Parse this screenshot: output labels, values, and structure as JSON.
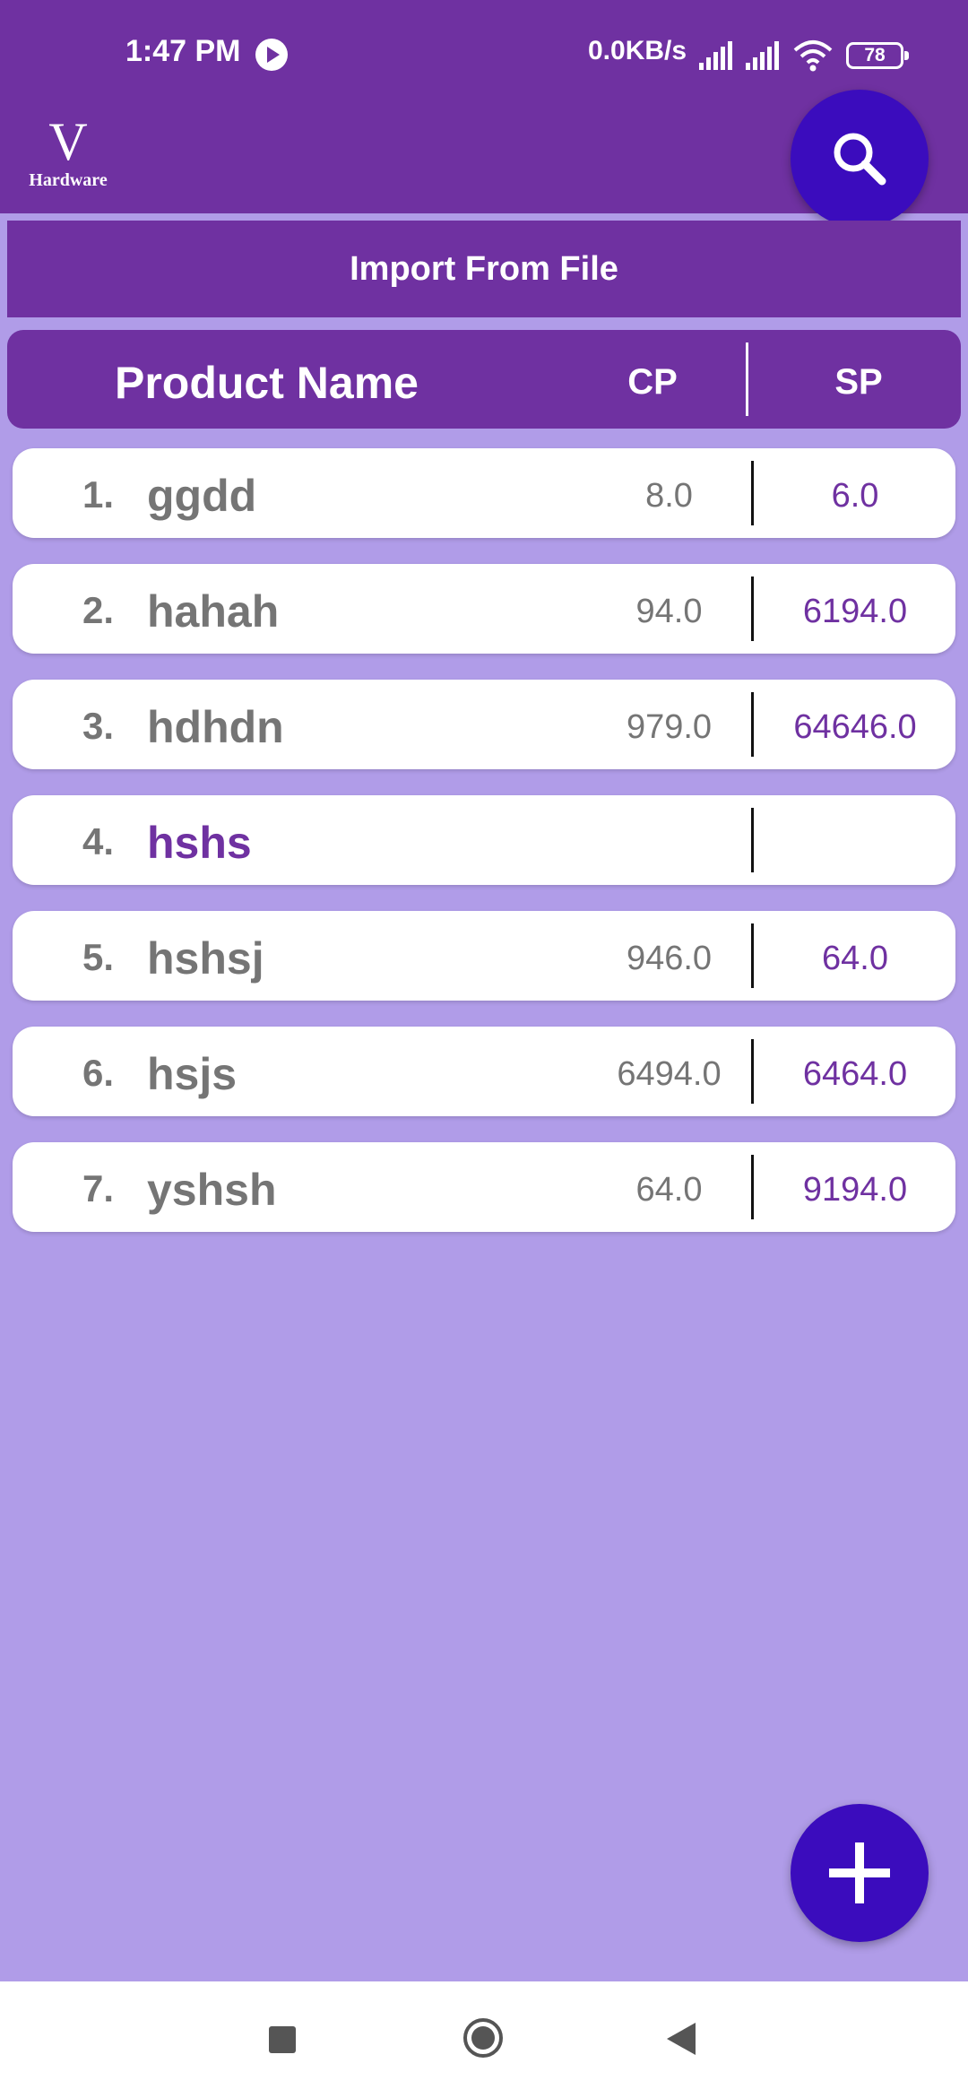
{
  "status_bar": {
    "time": "1:47 PM",
    "net_speed": "0.0KB/s",
    "battery": "78",
    "icons": [
      "play-icon",
      "signal-icon",
      "signal-icon",
      "wifi-icon",
      "battery-icon"
    ]
  },
  "app_bar": {
    "logo_letter": "V",
    "logo_text": "Hardware",
    "search_icon": "search-icon"
  },
  "import_label": "Import From File",
  "table_header": {
    "product_name": "Product Name",
    "cp": "CP",
    "sp": "SP"
  },
  "products": [
    {
      "num": "1.",
      "name": "ggdd",
      "cp": "8.0",
      "sp": "6.0"
    },
    {
      "num": "2.",
      "name": "hahah",
      "cp": "94.0",
      "sp": "6194.0"
    },
    {
      "num": "3.",
      "name": "hdhdn",
      "cp": "979.0",
      "sp": "64646.0"
    },
    {
      "num": "4.",
      "name": "hshs",
      "cp": "",
      "sp": ""
    },
    {
      "num": "5.",
      "name": "hshsj",
      "cp": "946.0",
      "sp": "64.0"
    },
    {
      "num": "6.",
      "name": "hsjs",
      "cp": "6494.0",
      "sp": "6464.0"
    },
    {
      "num": "7.",
      "name": "yshsh",
      "cp": "64.0",
      "sp": "9194.0"
    }
  ],
  "fab_icon": "plus-icon",
  "colors": {
    "primary": "#6f31a1",
    "fab": "#3b0cbd",
    "background": "#b09ce8",
    "text_grey": "#757575"
  }
}
